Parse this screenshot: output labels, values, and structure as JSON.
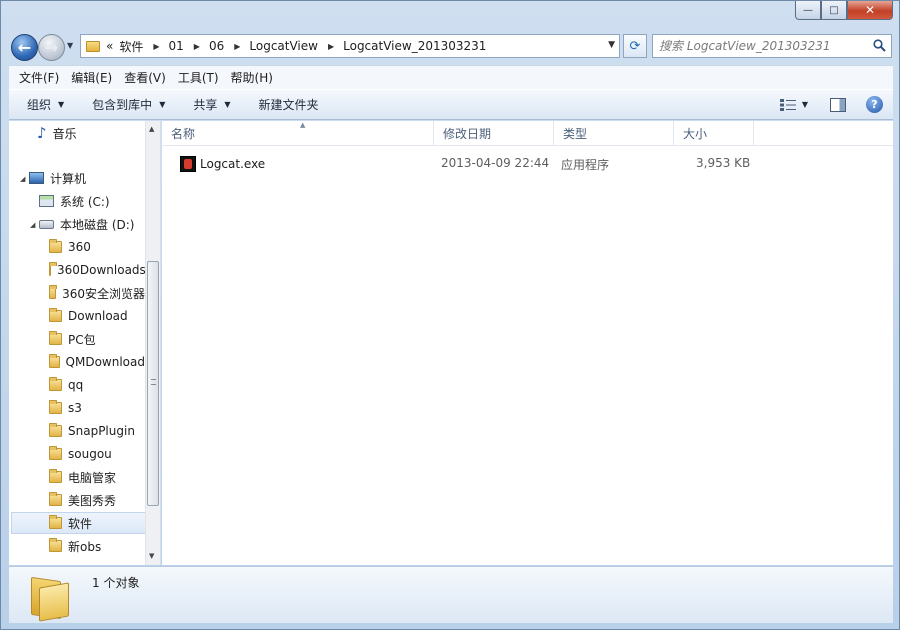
{
  "window": {
    "caption": {
      "minimize": "—",
      "maximize": "□",
      "close": "✕"
    }
  },
  "address": {
    "overflow": "«",
    "crumbs": [
      "软件",
      "01",
      "06",
      "LogcatView",
      "LogcatView_201303231"
    ]
  },
  "search": {
    "placeholder": "搜索 LogcatView_201303231"
  },
  "menu": [
    "文件(F)",
    "编辑(E)",
    "查看(V)",
    "工具(T)",
    "帮助(H)"
  ],
  "commands": {
    "organize": "组织",
    "include_library": "包含到库中",
    "share": "共享",
    "new_folder": "新建文件夹"
  },
  "nav": {
    "music": "音乐",
    "computer": "计算机",
    "drive_c": "系统 (C:)",
    "drive_d": "本地磁盘 (D:)",
    "folders": [
      "360",
      "360Downloads",
      "360安全浏览器",
      "Download",
      "PC包",
      "QMDownload",
      "qq",
      "s3",
      "SnapPlugin",
      "sougou",
      "电脑管家",
      "美图秀秀",
      "软件",
      "新obs"
    ],
    "selected": "软件"
  },
  "columns": {
    "name": "名称",
    "modified": "修改日期",
    "type": "类型",
    "size": "大小"
  },
  "files": [
    {
      "name": "Logcat.exe",
      "modified": "2013-04-09 22:44",
      "type": "应用程序",
      "size": "3,953 KB"
    }
  ],
  "status": {
    "count": "1 个对象"
  }
}
